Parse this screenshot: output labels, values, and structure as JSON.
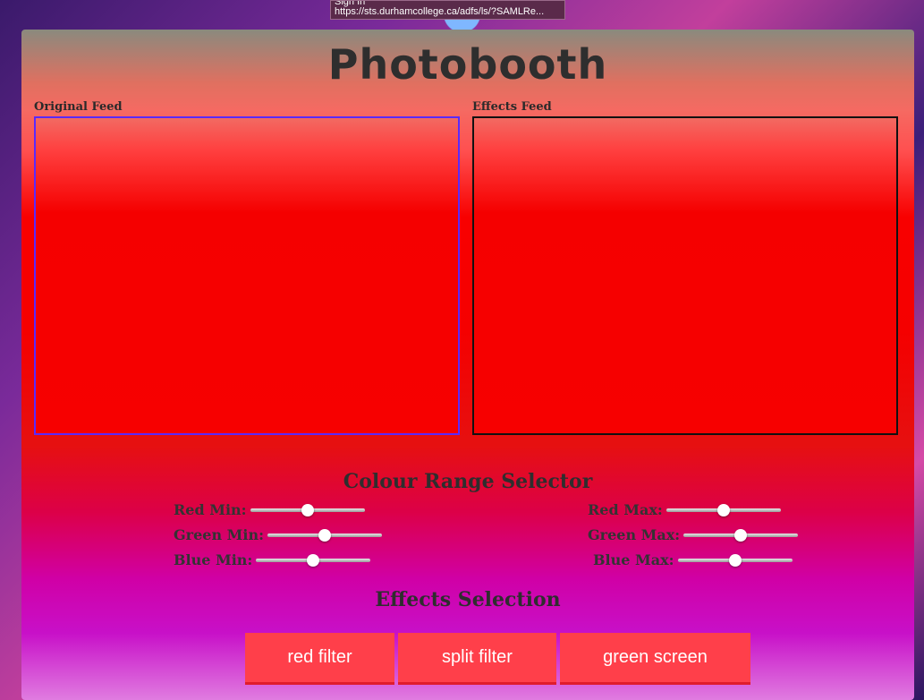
{
  "tooltip": {
    "line1": "Sign In",
    "line2": "https://sts.durhamcollege.ca/adfs/ls/?SAMLRe..."
  },
  "title": "Photobooth",
  "feeds": {
    "original_label": "Original Feed",
    "effects_label": "Effects Feed"
  },
  "colour_range": {
    "title": "Colour Range Selector",
    "red_min": {
      "label": "Red Min:",
      "value": 0.5
    },
    "green_min": {
      "label": "Green Min:",
      "value": 0.5
    },
    "blue_min": {
      "label": "Blue Min:",
      "value": 0.5
    },
    "red_max": {
      "label": "Red Max:",
      "value": 0.5
    },
    "green_max": {
      "label": "Green Max:",
      "value": 0.5
    },
    "blue_max": {
      "label": "Blue Max:",
      "value": 0.5
    }
  },
  "effects": {
    "title": "Effects Selection",
    "red_filter": "red filter",
    "split_filter": "split filter",
    "green_screen": "green screen"
  },
  "colors": {
    "button": "#ff3f4a",
    "original_border": "#5a2aff",
    "effects_border": "#111111"
  }
}
